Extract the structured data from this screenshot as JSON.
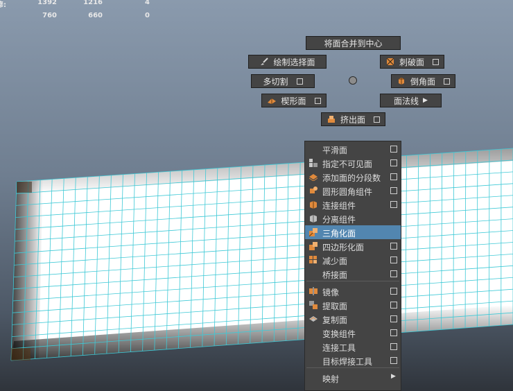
{
  "stats": {
    "row1": {
      "label": "修:",
      "v1": "1392",
      "v2": "1216",
      "v3": "4"
    },
    "row2": {
      "v1": "760",
      "v2": "660",
      "v3": "0"
    }
  },
  "marking_menu": {
    "merge_center": "将面合并到中心",
    "paint_select": "绘制选择面",
    "poke_face": "刺破面",
    "multi_cut": "多切割",
    "bevel": "倒角面",
    "wedge": "楔形面",
    "normals": "面法线",
    "extrude": "挤出面"
  },
  "context_menu": {
    "items": [
      {
        "label": "平滑面",
        "icon": "none",
        "option": true
      },
      {
        "label": "指定不可见面",
        "icon": "invisible-faces-icon",
        "option": true
      },
      {
        "label": "添加面的分段数",
        "icon": "add-divisions-icon",
        "option": true
      },
      {
        "label": "圆形圆角组件",
        "icon": "circularize-icon",
        "option": true
      },
      {
        "label": "连接组件",
        "icon": "connect-components-icon",
        "option": true
      },
      {
        "label": "分离组件",
        "icon": "detach-components-icon",
        "option": false
      },
      {
        "label": "三角化面",
        "icon": "triangulate-icon",
        "option": false,
        "highlighted": true
      },
      {
        "label": "四边形化面",
        "icon": "quadrangulate-icon",
        "option": true
      },
      {
        "label": "减少面",
        "icon": "reduce-icon",
        "option": true
      },
      {
        "label": "桥接面",
        "icon": "none",
        "option": true
      },
      {
        "label": "镜像",
        "icon": "mirror-icon",
        "option": true
      },
      {
        "label": "提取面",
        "icon": "extract-icon",
        "option": true
      },
      {
        "label": "复制面",
        "icon": "duplicate-icon",
        "option": true
      },
      {
        "label": "变换组件",
        "icon": "none",
        "option": true
      },
      {
        "label": "连接工具",
        "icon": "none",
        "option": true
      },
      {
        "label": "目标焊接工具",
        "icon": "none",
        "option": true
      },
      {
        "label": "映射",
        "icon": "none",
        "submenu": true
      }
    ]
  },
  "colors": {
    "highlight": "#5286b0",
    "wire": "#3ec9d6",
    "menu_bg": "#444444"
  }
}
